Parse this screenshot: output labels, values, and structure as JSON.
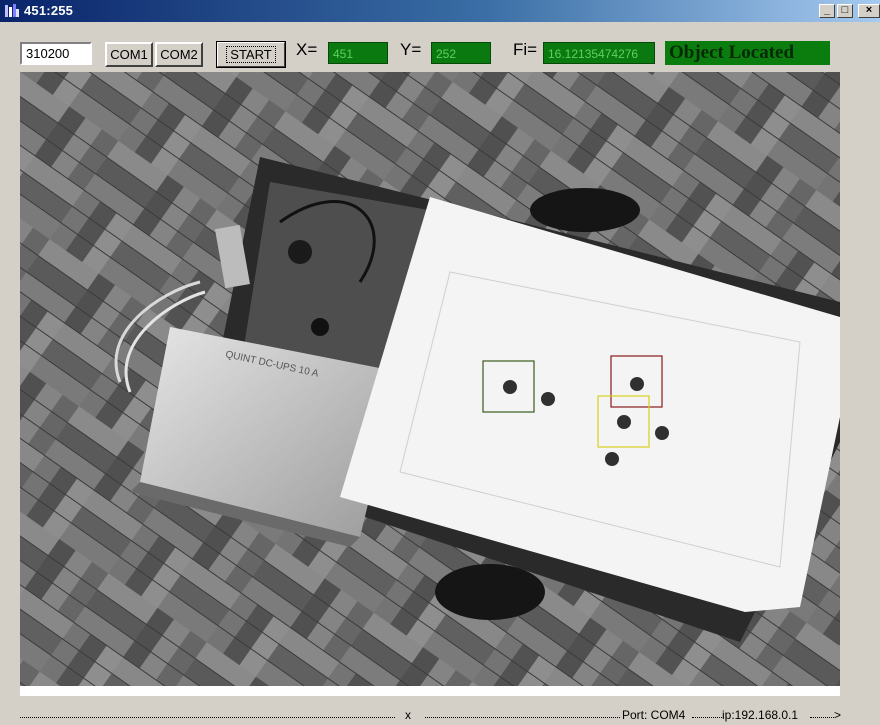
{
  "window": {
    "title": "451:255",
    "minimize_label": "_",
    "maximize_label": "□",
    "close_label": "×"
  },
  "toolbar": {
    "value_field": "310200",
    "com1_label": "COM1",
    "com2_label": "COM2",
    "start_label": "START",
    "x_label": "X=",
    "x_value": "451",
    "y_label": "Y=",
    "y_value": "252",
    "fi_label": "Fi=",
    "fi_value": "16.12135474276",
    "status_text": "Object Located"
  },
  "camera": {
    "module_label": "QUINT DC-UPS 10 A"
  },
  "statusbar": {
    "x_marker": "x",
    "port_text": "Port: COM4",
    "ip_text": "ip:192.168.0.1",
    "arrow": ">"
  },
  "colors": {
    "readout_bg": "#0a7a10",
    "readout_text": "#5fd05f",
    "marker_green": "#3a5a1a",
    "marker_red": "#8a1a1a",
    "marker_yellow": "#d8d020"
  }
}
